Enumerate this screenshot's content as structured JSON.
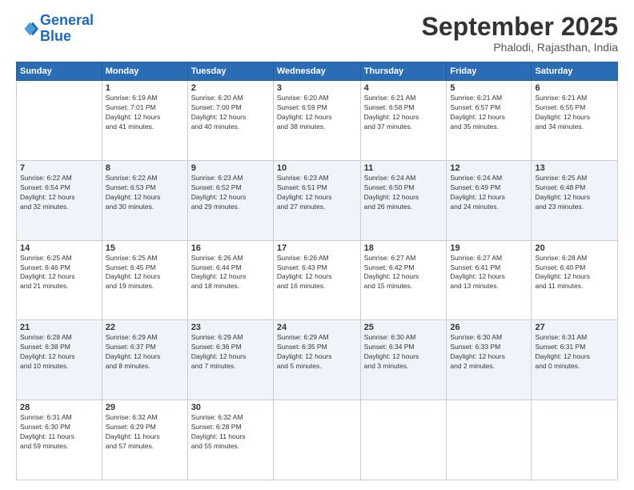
{
  "logo": {
    "line1": "General",
    "line2": "Blue"
  },
  "title": "September 2025",
  "subtitle": "Phalodi, Rajasthan, India",
  "days_of_week": [
    "Sunday",
    "Monday",
    "Tuesday",
    "Wednesday",
    "Thursday",
    "Friday",
    "Saturday"
  ],
  "weeks": [
    [
      {
        "day": "",
        "info": ""
      },
      {
        "day": "1",
        "info": "Sunrise: 6:19 AM\nSunset: 7:01 PM\nDaylight: 12 hours\nand 41 minutes."
      },
      {
        "day": "2",
        "info": "Sunrise: 6:20 AM\nSunset: 7:00 PM\nDaylight: 12 hours\nand 40 minutes."
      },
      {
        "day": "3",
        "info": "Sunrise: 6:20 AM\nSunset: 6:59 PM\nDaylight: 12 hours\nand 38 minutes."
      },
      {
        "day": "4",
        "info": "Sunrise: 6:21 AM\nSunset: 6:58 PM\nDaylight: 12 hours\nand 37 minutes."
      },
      {
        "day": "5",
        "info": "Sunrise: 6:21 AM\nSunset: 6:57 PM\nDaylight: 12 hours\nand 35 minutes."
      },
      {
        "day": "6",
        "info": "Sunrise: 6:21 AM\nSunset: 6:55 PM\nDaylight: 12 hours\nand 34 minutes."
      }
    ],
    [
      {
        "day": "7",
        "info": "Sunrise: 6:22 AM\nSunset: 6:54 PM\nDaylight: 12 hours\nand 32 minutes."
      },
      {
        "day": "8",
        "info": "Sunrise: 6:22 AM\nSunset: 6:53 PM\nDaylight: 12 hours\nand 30 minutes."
      },
      {
        "day": "9",
        "info": "Sunrise: 6:23 AM\nSunset: 6:52 PM\nDaylight: 12 hours\nand 29 minutes."
      },
      {
        "day": "10",
        "info": "Sunrise: 6:23 AM\nSunset: 6:51 PM\nDaylight: 12 hours\nand 27 minutes."
      },
      {
        "day": "11",
        "info": "Sunrise: 6:24 AM\nSunset: 6:50 PM\nDaylight: 12 hours\nand 26 minutes."
      },
      {
        "day": "12",
        "info": "Sunrise: 6:24 AM\nSunset: 6:49 PM\nDaylight: 12 hours\nand 24 minutes."
      },
      {
        "day": "13",
        "info": "Sunrise: 6:25 AM\nSunset: 6:48 PM\nDaylight: 12 hours\nand 23 minutes."
      }
    ],
    [
      {
        "day": "14",
        "info": "Sunrise: 6:25 AM\nSunset: 6:46 PM\nDaylight: 12 hours\nand 21 minutes."
      },
      {
        "day": "15",
        "info": "Sunrise: 6:25 AM\nSunset: 6:45 PM\nDaylight: 12 hours\nand 19 minutes."
      },
      {
        "day": "16",
        "info": "Sunrise: 6:26 AM\nSunset: 6:44 PM\nDaylight: 12 hours\nand 18 minutes."
      },
      {
        "day": "17",
        "info": "Sunrise: 6:26 AM\nSunset: 6:43 PM\nDaylight: 12 hours\nand 16 minutes."
      },
      {
        "day": "18",
        "info": "Sunrise: 6:27 AM\nSunset: 6:42 PM\nDaylight: 12 hours\nand 15 minutes."
      },
      {
        "day": "19",
        "info": "Sunrise: 6:27 AM\nSunset: 6:41 PM\nDaylight: 12 hours\nand 13 minutes."
      },
      {
        "day": "20",
        "info": "Sunrise: 6:28 AM\nSunset: 6:40 PM\nDaylight: 12 hours\nand 11 minutes."
      }
    ],
    [
      {
        "day": "21",
        "info": "Sunrise: 6:28 AM\nSunset: 6:38 PM\nDaylight: 12 hours\nand 10 minutes."
      },
      {
        "day": "22",
        "info": "Sunrise: 6:29 AM\nSunset: 6:37 PM\nDaylight: 12 hours\nand 8 minutes."
      },
      {
        "day": "23",
        "info": "Sunrise: 6:29 AM\nSunset: 6:36 PM\nDaylight: 12 hours\nand 7 minutes."
      },
      {
        "day": "24",
        "info": "Sunrise: 6:29 AM\nSunset: 6:35 PM\nDaylight: 12 hours\nand 5 minutes."
      },
      {
        "day": "25",
        "info": "Sunrise: 6:30 AM\nSunset: 6:34 PM\nDaylight: 12 hours\nand 3 minutes."
      },
      {
        "day": "26",
        "info": "Sunrise: 6:30 AM\nSunset: 6:33 PM\nDaylight: 12 hours\nand 2 minutes."
      },
      {
        "day": "27",
        "info": "Sunrise: 6:31 AM\nSunset: 6:31 PM\nDaylight: 12 hours\nand 0 minutes."
      }
    ],
    [
      {
        "day": "28",
        "info": "Sunrise: 6:31 AM\nSunset: 6:30 PM\nDaylight: 11 hours\nand 59 minutes."
      },
      {
        "day": "29",
        "info": "Sunrise: 6:32 AM\nSunset: 6:29 PM\nDaylight: 11 hours\nand 57 minutes."
      },
      {
        "day": "30",
        "info": "Sunrise: 6:32 AM\nSunset: 6:28 PM\nDaylight: 11 hours\nand 55 minutes."
      },
      {
        "day": "",
        "info": ""
      },
      {
        "day": "",
        "info": ""
      },
      {
        "day": "",
        "info": ""
      },
      {
        "day": "",
        "info": ""
      }
    ]
  ]
}
